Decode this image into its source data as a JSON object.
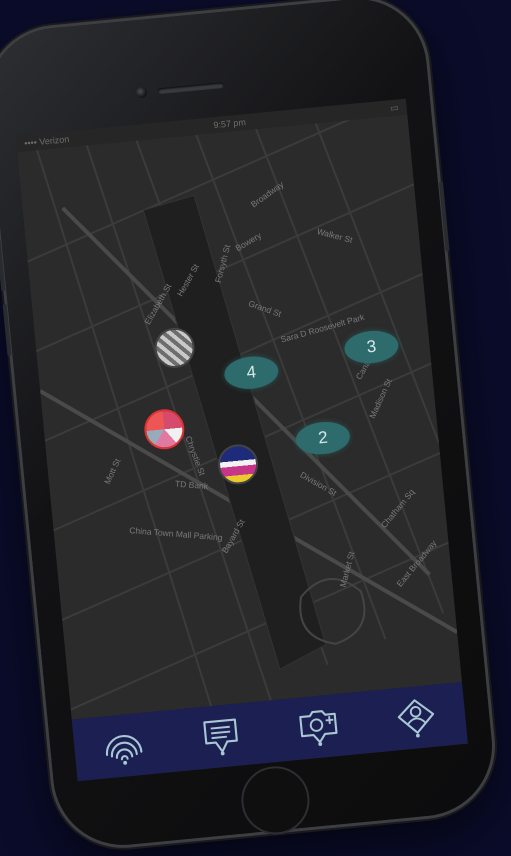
{
  "status_bar": {
    "carrier": "•••• Verizon",
    "time": "9:57 pm",
    "battery": "▭"
  },
  "map": {
    "street_labels": [
      "Broadway",
      "Bowery",
      "Chrystie St",
      "Hester St",
      "Grand St",
      "Elizabeth St",
      "Mott St",
      "Canal St",
      "Walker St",
      "Bayard St",
      "Division St",
      "Market St",
      "Madison St",
      "Forsyth St",
      "East Broadway",
      "TD Bank",
      "China Town Mall Parking",
      "Sara D Roosevelt Park",
      "Chatham Sq"
    ],
    "clusters": [
      "4",
      "3",
      "2"
    ],
    "pins": [
      "user-photo-pin",
      "user-photo-pin",
      "user-photo-pin"
    ]
  },
  "tabbar": {
    "items": [
      {
        "name": "nearby",
        "icon": "signal-icon"
      },
      {
        "name": "feed",
        "icon": "message-list-icon"
      },
      {
        "name": "add-photo",
        "icon": "camera-plus-icon"
      },
      {
        "name": "profile",
        "icon": "user-icon"
      }
    ]
  },
  "colors": {
    "background": "#0a0c2a",
    "tabbar": "#1b1f52",
    "cluster": "#2e6b6c",
    "icon": "#a9c7d3"
  }
}
